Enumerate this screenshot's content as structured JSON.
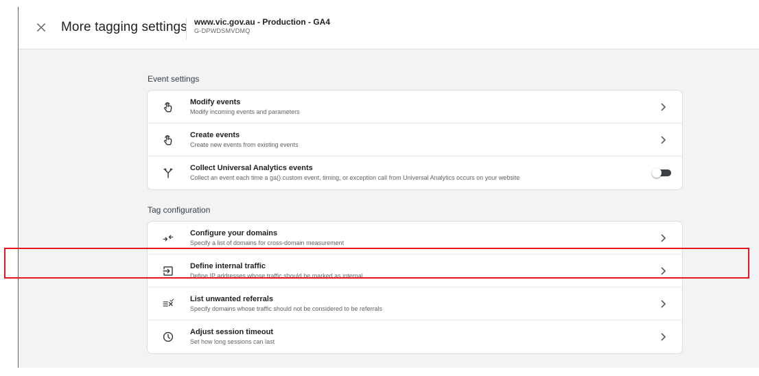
{
  "header": {
    "title": "More tagging settings",
    "property_name": "www.vic.gov.au - Production - GA4",
    "property_id": "G-DPWDSMVDMQ"
  },
  "event_settings": {
    "title": "Event settings",
    "items": [
      {
        "title": "Modify events",
        "description": "Modify incoming events and parameters",
        "icon": "touch-icon"
      },
      {
        "title": "Create events",
        "description": "Create new events from existing events",
        "icon": "touch-icon"
      },
      {
        "title": "Collect Universal Analytics events",
        "description": "Collect an event each time a ga() custom event, timing, or exception call from Universal Analytics occurs on your website",
        "icon": "merge-icon",
        "toggle_on": false
      }
    ]
  },
  "tag_configuration": {
    "title": "Tag configuration",
    "items": [
      {
        "title": "Configure your domains",
        "description": "Specify a list of domains for cross-domain measurement",
        "icon": "cross-domain-icon"
      },
      {
        "title": "Define internal traffic",
        "description": "Define IP addresses whose traffic should be marked as internal",
        "icon": "login-icon"
      },
      {
        "title": "List unwanted referrals",
        "description": "Specify domains whose traffic should not be considered to be referrals",
        "icon": "filter-off-icon"
      },
      {
        "title": "Adjust session timeout",
        "description": "Set how long sessions can last",
        "icon": "clock-icon"
      }
    ]
  },
  "colors": {
    "highlight": "#e8141a",
    "background": "#f1f3f4",
    "text_primary": "#202124",
    "text_secondary": "#5f6368"
  }
}
